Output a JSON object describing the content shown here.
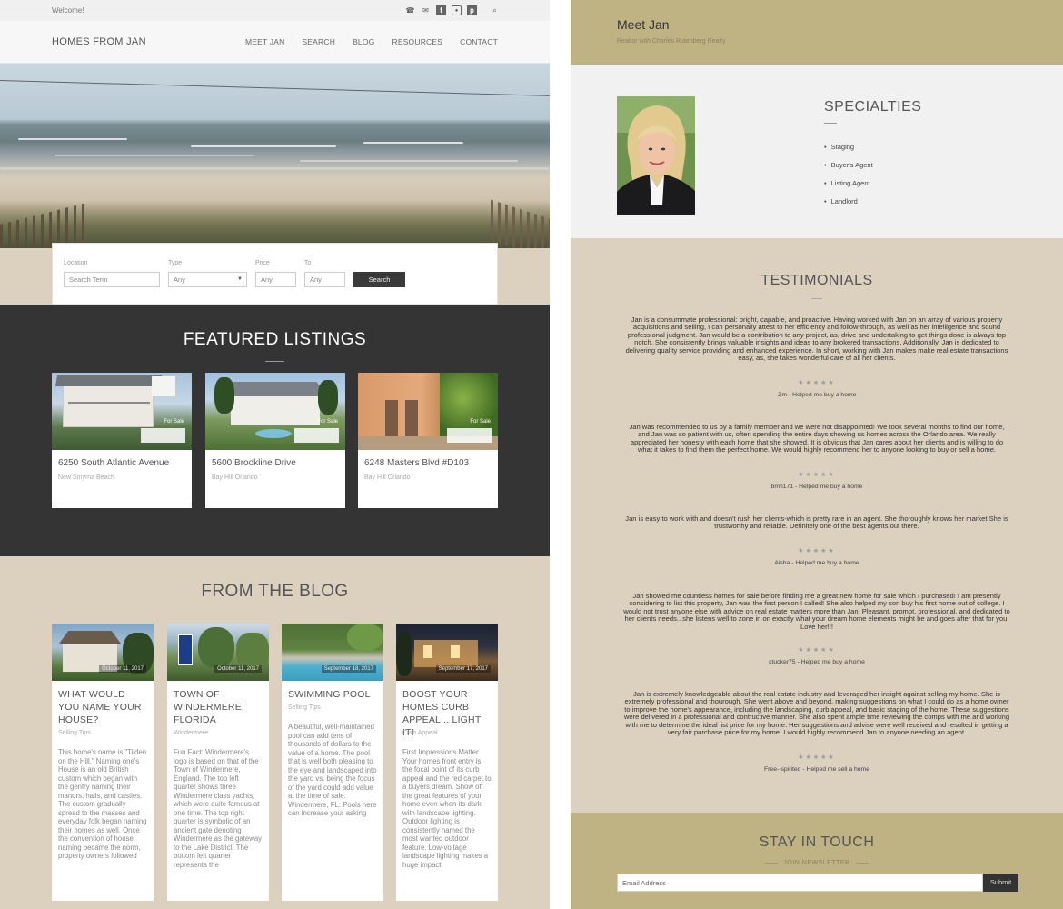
{
  "topbar": {
    "welcome": "Welcome!",
    "social_icons": [
      "phone-icon",
      "mail-icon",
      "facebook-icon",
      "instagram-icon",
      "pinterest-icon"
    ],
    "search_icon": "search-icon"
  },
  "header": {
    "brand": "HOMES FROM JAN",
    "nav": [
      "MEET JAN",
      "SEARCH",
      "BLOG",
      "RESOURCES",
      "CONTACT"
    ]
  },
  "search": {
    "location_label": "Location",
    "location_placeholder": "Search Term",
    "type_label": "Type",
    "type_value": "Any",
    "price_label": "Price",
    "price_placeholder": "Any",
    "to_label": "To",
    "to_placeholder": "Any",
    "button": "Search"
  },
  "featured": {
    "title": "FEATURED LISTINGS",
    "listings": [
      {
        "tag": "For Sale",
        "address": "6250 South Atlantic Avenue",
        "location": "New Smyrna Beach"
      },
      {
        "tag": "For Sale",
        "address": "5600 Brookline Drive",
        "location": "Bay Hill     Orlando"
      },
      {
        "tag": "For Sale",
        "address": "6248 Masters Blvd #D103",
        "location": "Bay Hill     Orlando"
      }
    ]
  },
  "blog": {
    "title": "FROM THE BLOG",
    "posts": [
      {
        "date": "October 11, 2017",
        "title": "WHAT WOULD YOU NAME YOUR HOUSE?",
        "category": "Selling Tips",
        "excerpt": "This home's name is \"Tilden on the Hill.\" Naming one's House is an old British custom which began with the gentry naming their manors, halls, and castles. The custom gradually spread to the masses and everyday folk began naming their homes as well. Once the convention of house naming became the norm, property owners followed"
      },
      {
        "date": "October 11, 2017",
        "title": "TOWN OF WINDERMERE, FLORIDA",
        "category": "Windermere",
        "excerpt": "Fun Fact: Windermere's logo is based on that of the Town of Windermere, England. The top left quarter shows three Windermere class yachts, which were quite famous at one time. The top right quarter is symbolic of an ancient gate denoting Windermere as the gateway to the Lake District. The bottom left quarter represents the"
      },
      {
        "date": "September 18, 2017",
        "title": "SWIMMING POOL",
        "category": "Selling Tips",
        "excerpt": "A beautiful, well-maintained pool can add tens of thousands of dollars to the value of a home. The pool that is well both pleasing to the eye and landscaped into the yard vs. being the focus of the yard could add value at the time of sale. Windermere, FL: Pools here can increase your asking"
      },
      {
        "date": "September 17, 2017",
        "title": "BOOST YOUR HOMES CURB APPEAL... LIGHT IT!",
        "category": "Curb Appeal",
        "excerpt": "First Impressions Matter Your homes front entry is the focal point of its curb appeal and the red carpet to a buyers dream. Show off the great features of your home even when its dark with landscape lighting. Outdoor lighting is consistently named the most wanted outdoor feature. Low-voltage landscape lighting makes a huge impact"
      }
    ]
  },
  "meet": {
    "name": "Meet Jan",
    "subtitle": "Realtor with Charles Rutenberg Realty"
  },
  "specialties": {
    "title": "SPECIALTIES",
    "items": [
      "Staging",
      "Buyer's Agent",
      "Listing Agent",
      "Landlord"
    ]
  },
  "testimonials": {
    "title": "TESTIMONIALS",
    "stars": "★★★★★",
    "items": [
      {
        "text": "Jan is a consummate professional: bright, capable, and proactive. Having worked with Jan on an array of various property acquisitions and selling, I can personally attest to her efficiency and follow-through, as well as her intelligence and sound professional judgment. Jan would be a contribution to any project, as, drive and undertaking to get things done is always top notch. She consistently brings valuable insights and ideas to any brokered transactions. Additionally, Jan is dedicated to delivering quality service providing and enhanced experience. In short, working with Jan makes make real estate transactions easy, as, she takes wonderful care of all her clients.",
        "by": "Jim - Helped me buy a home"
      },
      {
        "text": "Jan was recommended to us by a family member and we were not disappointed! We took several months to find our home, and Jan was so patient with us, often spending the entire days showing us homes across the Orlando area. We really appreciated her honesty with each home that she showed. It is obvious that Jan cares about her clients and is willing to do what it takes to find them the perfect home. We would highly recommend her to anyone looking to buy or sell a home.",
        "by": "bmh171 - Helped me buy a home"
      },
      {
        "text": "Jan is easy to work with and doesn't rush her clients-which is pretty rare in an agent. She thoroughly knows her market.She is trustworthy and reliable. Definitely one of the best agents out there.",
        "by": "Aisha - Helped me buy a home"
      },
      {
        "text": "Jan showed me countless homes for sale before finding me a great new home for sale which I purchased! I am presently considering to list this property, Jan was the first person I called! She also helped my son buy his first home out of college. I would not trust anyone else with advice on real estate matters more than Jan! Pleasant, prompt, professional, and dedicated to her clients needs...she listens well to zone in on exactly what your dream home elements might be and goes after that for you! Love her!!!",
        "by": "ctucker75 - Helped me buy a home"
      },
      {
        "text": "Jan is extremely knowledgeable about the real estate industry and leveraged her insight against selling my home. She is extremely professional and thourough. She went above and beyond, making suggestions on what I could do as a home owner to improve the home's appearance, including the landscaping, curb appeal, and basic staging of the home. These suggestions were delivered in a professional and contructive manner. She also spent ample time reviewing the comps with me and working with me to determine the ideal list price for my home. Her suggestions and advise were well received and resulted in getting a very fair purchase price for my home. I would highly recommend Jan to anyone needing an agent.",
        "by": "Free--spirited - Helped me sell a home"
      }
    ]
  },
  "newsletter": {
    "title": "STAY IN TOUCH",
    "subtitle": "JOIN NEWSLETTER",
    "email_placeholder": "Email Address",
    "submit": "Submit"
  }
}
